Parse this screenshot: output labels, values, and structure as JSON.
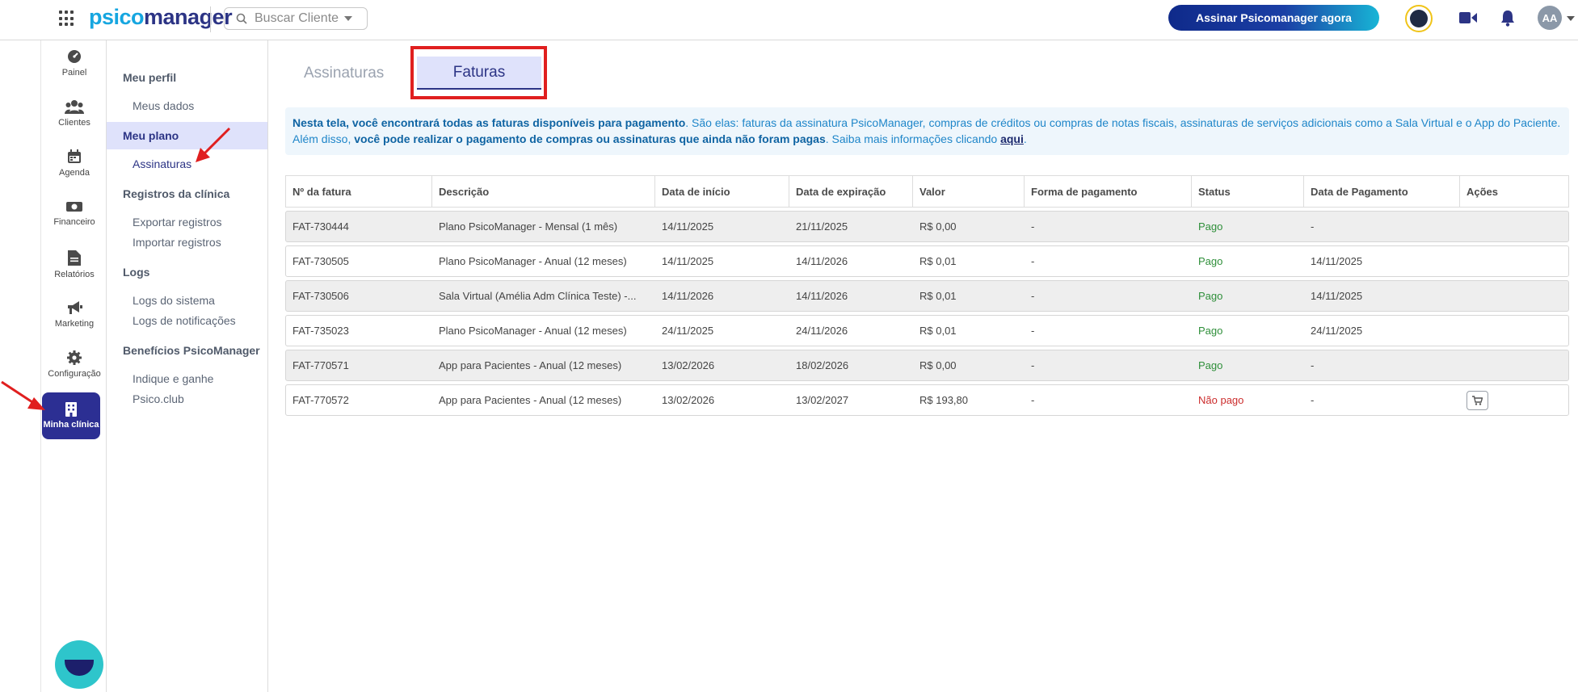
{
  "app": {
    "logo_part1": "psico",
    "logo_part2": "manager",
    "search_label": "Buscar Cliente",
    "cta_label": "Assinar Psicomanager agora",
    "avatar_initials": "AA"
  },
  "rail": {
    "items": [
      {
        "label": "Painel",
        "icon": "dashboard-icon"
      },
      {
        "label": "Clientes",
        "icon": "users-icon"
      },
      {
        "label": "Agenda",
        "icon": "calendar-icon"
      },
      {
        "label": "Financeiro",
        "icon": "money-icon"
      },
      {
        "label": "Relatórios",
        "icon": "file-icon"
      },
      {
        "label": "Marketing",
        "icon": "megaphone-icon"
      },
      {
        "label": "Configuração",
        "icon": "gear-icon"
      },
      {
        "label": "Minha clínica",
        "icon": "building-icon"
      }
    ]
  },
  "submenu": {
    "meu_perfil": "Meu perfil",
    "meus_dados": "Meus dados",
    "meu_plano": "Meu plano",
    "assinaturas": "Assinaturas",
    "registros": "Registros da clínica",
    "exportar": "Exportar registros",
    "importar": "Importar registros",
    "logs": "Logs",
    "logs_sistema": "Logs do sistema",
    "logs_notificacoes": "Logs de notificações",
    "beneficios": "Benefícios PsicoManager",
    "indique": "Indique e ganhe",
    "psicoclub": "Psico.club"
  },
  "tabs": {
    "assinaturas": "Assinaturas",
    "faturas": "Faturas"
  },
  "info": {
    "bold1": "Nesta tela, você encontrará todas as faturas disponíveis para pagamento",
    "text1": ". São elas: faturas da assinatura PsicoManager, compras de créditos ou compras de notas fiscais, assinaturas de serviços adicionais como a Sala Virtual e o App do Paciente.",
    "text2": "Além disso, ",
    "bold2": "você pode realizar o pagamento de compras ou assinaturas que ainda não foram pagas",
    "text3": ". Saiba mais informações clicando ",
    "link": "aqui",
    "text4": "."
  },
  "table": {
    "headers": [
      "Nº da fatura",
      "Descrição",
      "Data de início",
      "Data de expiração",
      "Valor",
      "Forma de pagamento",
      "Status",
      "Data de Pagamento",
      "Ações"
    ],
    "rows": [
      {
        "num": "FAT-730444",
        "desc": "Plano PsicoManager - Mensal (1 mês)",
        "start": "14/11/2025",
        "end": "21/11/2025",
        "value": "R$ 0,00",
        "method": "-",
        "status": "Pago",
        "paid": "-"
      },
      {
        "num": "FAT-730505",
        "desc": "Plano PsicoManager - Anual (12 meses)",
        "start": "14/11/2025",
        "end": "14/11/2026",
        "value": "R$ 0,01",
        "method": "-",
        "status": "Pago",
        "paid": "14/11/2025"
      },
      {
        "num": "FAT-730506",
        "desc": "Sala Virtual (Amélia Adm Clínica Teste) -...",
        "start": "14/11/2026",
        "end": "14/11/2026",
        "value": "R$ 0,01",
        "method": "-",
        "status": "Pago",
        "paid": "14/11/2025"
      },
      {
        "num": "FAT-735023",
        "desc": "Plano PsicoManager - Anual (12 meses)",
        "start": "24/11/2025",
        "end": "24/11/2026",
        "value": "R$ 0,01",
        "method": "-",
        "status": "Pago",
        "paid": "24/11/2025"
      },
      {
        "num": "FAT-770571",
        "desc": "App para Pacientes - Anual (12 meses)",
        "start": "13/02/2026",
        "end": "18/02/2026",
        "value": "R$ 0,00",
        "method": "-",
        "status": "Pago",
        "paid": "-"
      },
      {
        "num": "FAT-770572",
        "desc": "App para Pacientes - Anual (12 meses)",
        "start": "13/02/2026",
        "end": "13/02/2027",
        "value": "R$ 193,80",
        "method": "-",
        "status": "Não pago",
        "paid": "-"
      }
    ]
  },
  "colors": {
    "brand_navy": "#2c3485",
    "brand_cyan": "#16a6e0",
    "active_bg": "#dfe2fb",
    "paid": "#2f8f3a",
    "unpaid": "#cc2d2d",
    "highlight": "#e01f1f"
  }
}
